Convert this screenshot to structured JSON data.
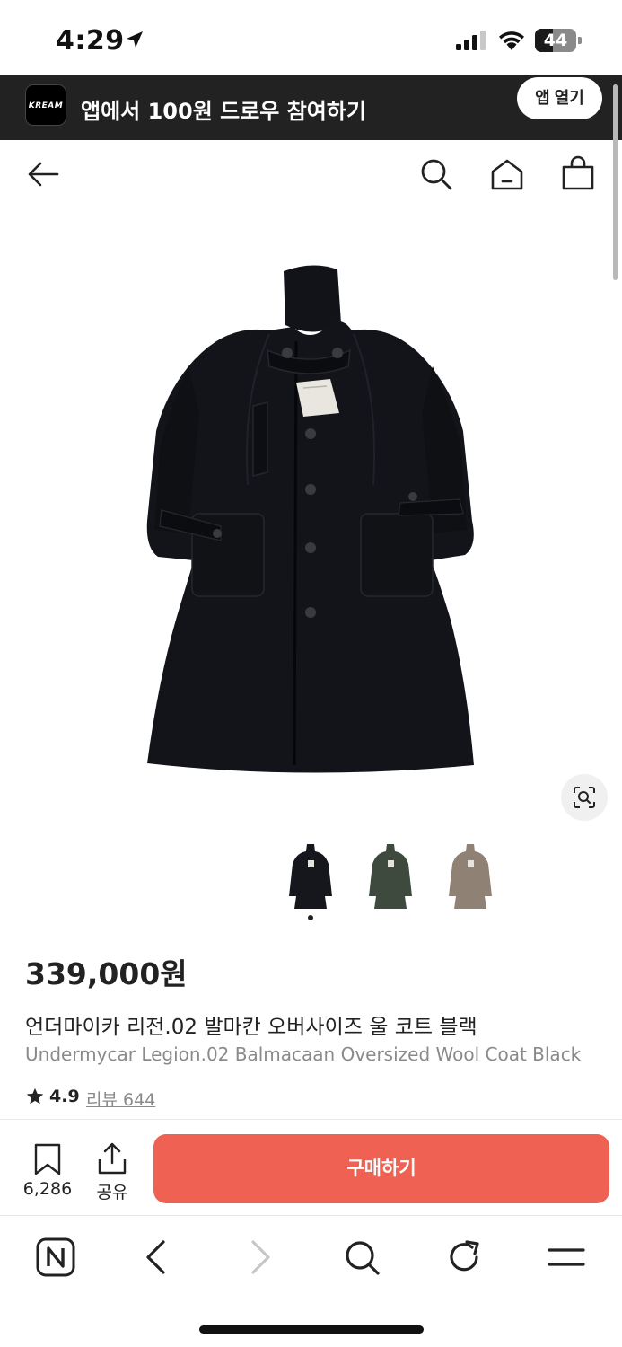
{
  "status_bar": {
    "time": "4:29",
    "battery": "44",
    "battery_level": 0.44
  },
  "app_banner": {
    "logo_text": "KREAM",
    "message": "앱에서 100원 드로우 참여하기",
    "open_app_label": "앱 열기"
  },
  "header": {
    "back_icon": "arrow-left-icon",
    "search_icon": "search-icon",
    "home_icon": "home-icon",
    "bag_icon": "shopping-bag-icon"
  },
  "product": {
    "image_icon": "coat-image",
    "price": "339,000원",
    "name_ko": "언더마이카 리전.02 발마칸 오버사이즈 울 코트 블랙",
    "name_en": "Undermycar Legion.02 Balmacaan Oversized Wool Coat Black",
    "rating": "4.9",
    "review_label": "리뷰 644",
    "thumbnails": [
      {
        "color": "#15171c"
      },
      {
        "color": "#3f4a3e"
      },
      {
        "color": "#8f8274"
      }
    ],
    "selected_thumbnail": 0
  },
  "action_bar": {
    "wish_count": "6,286",
    "share_label": "공유",
    "buy_label": "구매하기",
    "buy_color": "#ef6253"
  },
  "browser_bar": {
    "icons": [
      "naver-icon",
      "back-icon",
      "forward-icon",
      "search-icon",
      "reload-icon",
      "menu-icon"
    ]
  }
}
